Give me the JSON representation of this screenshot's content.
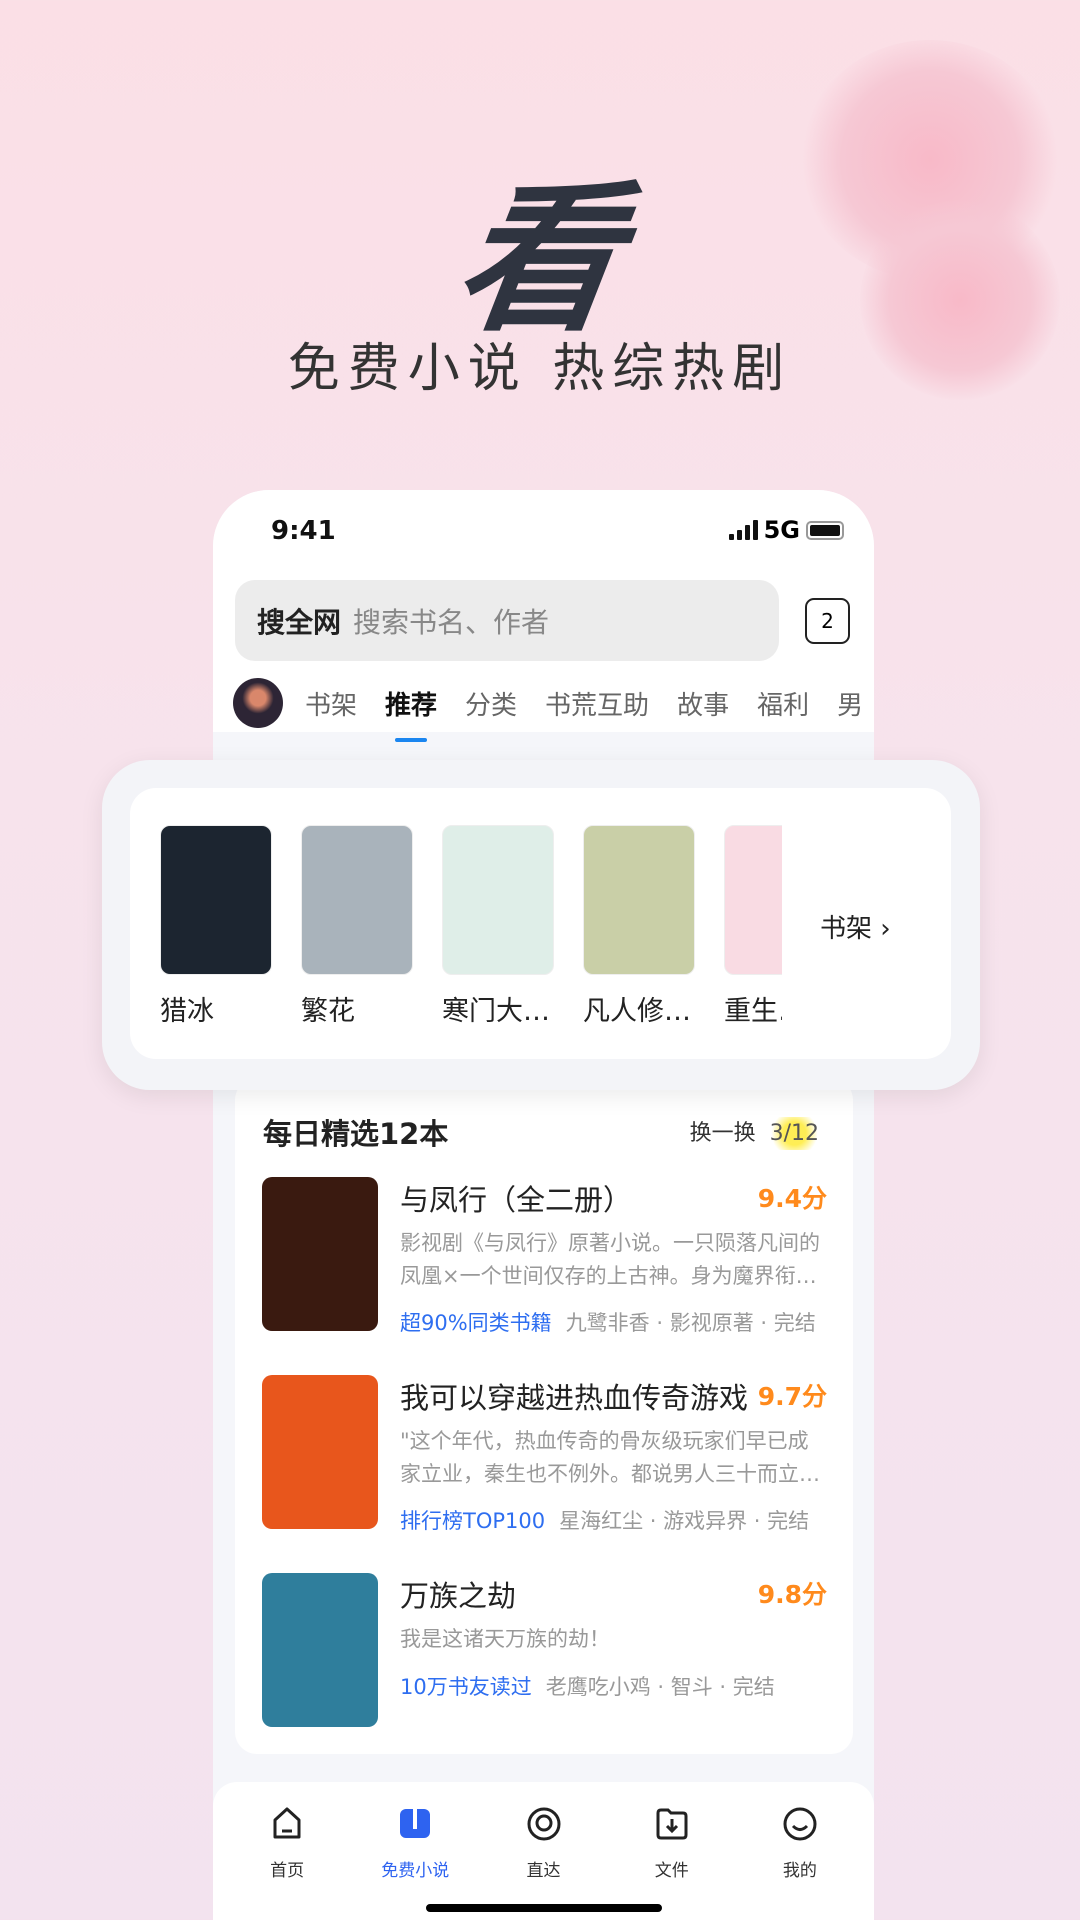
{
  "hero": {
    "title": "看",
    "subtitle": "免费小说 热综热剧"
  },
  "status": {
    "time": "9:41",
    "network": "5G"
  },
  "search": {
    "prefix": "搜全网",
    "placeholder": "搜索书名、作者",
    "tab_count": "2"
  },
  "tabs": [
    {
      "label": "书架"
    },
    {
      "label": "推荐",
      "active": true
    },
    {
      "label": "分类"
    },
    {
      "label": "书荒互助"
    },
    {
      "label": "故事"
    },
    {
      "label": "福利"
    },
    {
      "label": "男"
    }
  ],
  "shelf": {
    "books": [
      {
        "title": "猎冰",
        "color": "#1c2530"
      },
      {
        "title": "繁花",
        "color": "#a9b3bb"
      },
      {
        "title": "寒门大…",
        "color": "#dfeee8"
      },
      {
        "title": "凡人修…",
        "color": "#c9cfa7"
      },
      {
        "title": "重生…",
        "color": "#f9dbe3"
      }
    ],
    "link": "书架 ›"
  },
  "daily": {
    "title": "每日精选12本",
    "swap": "换一换",
    "page": "3/12",
    "items": [
      {
        "title": "与凤行（全二册）",
        "score": "9.4分",
        "desc": "影视剧《与凤行》原著小说。一只陨落凡间的凤凰×一个世间仅存的上古神。身为魔界衔…",
        "highlight": "超90%同类书籍",
        "meta": "九鹭非香 · 影视原著 · 完结",
        "color": "#3a1a10"
      },
      {
        "title": "我可以穿越进热血传奇游戏",
        "score": "9.7分",
        "desc": "\"这个年代，热血传奇的骨灰级玩家们早已成家立业，秦生也不例外。都说男人三十而立…",
        "highlight": "排行榜TOP100",
        "meta": "星海红尘 · 游戏异界 · 完结",
        "color": "#e8561c"
      },
      {
        "title": "万族之劫",
        "score": "9.8分",
        "desc": "我是这诸天万族的劫！",
        "highlight": "10万书友读过",
        "meta": "老鹰吃小鸡 · 智斗 · 完结",
        "color": "#2f7e9c"
      }
    ]
  },
  "nav": [
    {
      "label": "首页",
      "icon": "home-icon"
    },
    {
      "label": "免费小说",
      "icon": "book-icon",
      "active": true
    },
    {
      "label": "直达",
      "icon": "direct-icon"
    },
    {
      "label": "文件",
      "icon": "file-icon"
    },
    {
      "label": "我的",
      "icon": "profile-icon"
    }
  ],
  "colors": {
    "accent": "#2e63f0",
    "score": "#ff8a1c",
    "tab_underline": "#1b86f0"
  }
}
